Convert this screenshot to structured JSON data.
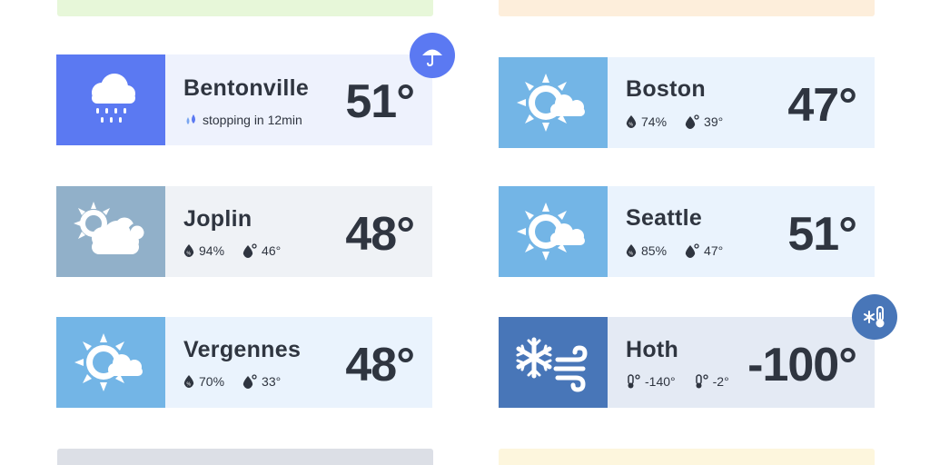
{
  "cards": [
    {
      "city": "Bentonville",
      "temp": "51°",
      "stat1": "stopping in 12min",
      "icon": "rain-cloud-icon",
      "badge": "umbrella-icon"
    },
    {
      "city": "Boston",
      "temp": "47°",
      "stat1": "74%",
      "stat2": "39°",
      "icon": "sun-cloud-icon"
    },
    {
      "city": "Joplin",
      "temp": "48°",
      "stat1": "94%",
      "stat2": "46°",
      "icon": "partly-cloudy-icon"
    },
    {
      "city": "Seattle",
      "temp": "51°",
      "stat1": "85%",
      "stat2": "47°",
      "icon": "sun-cloud-icon"
    },
    {
      "city": "Vergennes",
      "temp": "48°",
      "stat1": "70%",
      "stat2": "33°",
      "icon": "sun-cloud-icon"
    },
    {
      "city": "Hoth",
      "temp": "-100°",
      "stat1": "-140°",
      "stat2": "-2°",
      "icon": "snow-wind-icon",
      "badge": "cold-thermometer-icon"
    }
  ],
  "colors": {
    "text": "#2f3540",
    "rain_icon_bg": "#5b79f2",
    "sky_icon_bg": "#73b5e6",
    "grey_icon_bg": "#91b0c9",
    "snow_icon_bg": "#4876b8",
    "card_bg_blue": "#eaf3fd",
    "card_bg_grey": "#eff2f6",
    "card_bg_rain": "#eef2fd",
    "stub_green": "#e7f7d9",
    "stub_orange": "#fdeedb",
    "stub_grey": "#dcdfe6",
    "stub_yellow": "#fdf6dd"
  }
}
